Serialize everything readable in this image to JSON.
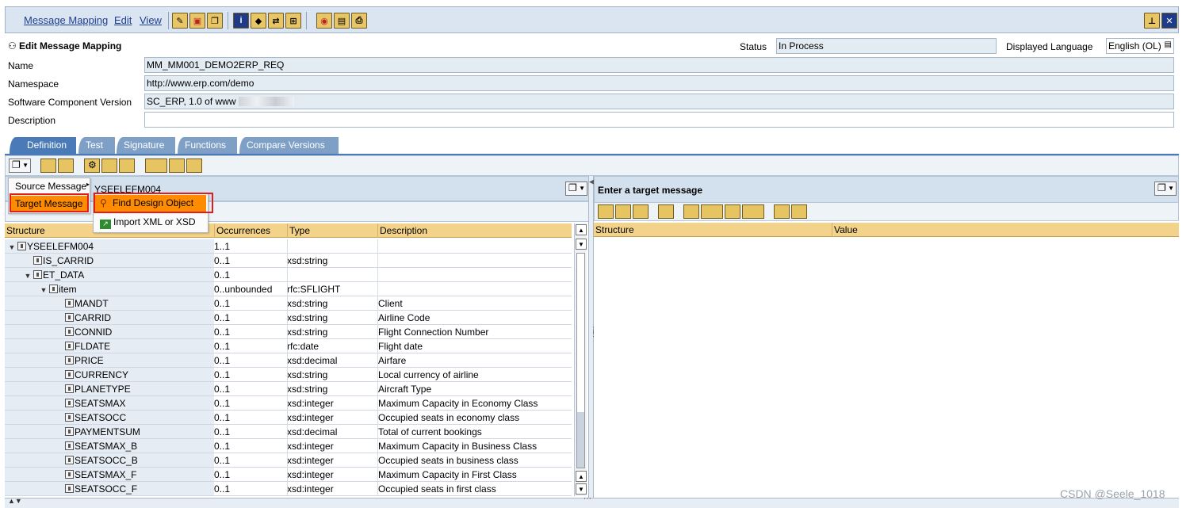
{
  "menu": {
    "items": [
      "Message Mapping",
      "Edit",
      "View"
    ]
  },
  "header": {
    "title": "Edit Message Mapping",
    "status_label": "Status",
    "status_value": "In Process",
    "language_label": "Displayed Language",
    "language_value": "English (OL)",
    "name_label": "Name",
    "name_value": "MM_MM001_DEMO2ERP_REQ",
    "namespace_label": "Namespace",
    "namespace_value": "http://www.erp.com/demo",
    "scv_label": "Software Component Version",
    "scv_value": "SC_ERP, 1.0 of www",
    "description_label": "Description",
    "description_value": ""
  },
  "tabs": [
    "Definition",
    "Test",
    "Signature",
    "Functions",
    "Compare Versions"
  ],
  "popup": {
    "source_message": "Source Message",
    "target_message": "Target Message",
    "find_design_object": "Find Design Object",
    "import_xml": "Import XML or XSD"
  },
  "left_panel": {
    "title": "YSEELEFM004",
    "columns": [
      "Structure",
      "Occurrences",
      "Type",
      "Description"
    ],
    "rows": [
      {
        "name": "YSEELEFM004",
        "occ": "1..1",
        "type": "",
        "desc": ""
      },
      {
        "name": "IS_CARRID",
        "occ": "0..1",
        "type": "xsd:string",
        "desc": ""
      },
      {
        "name": "ET_DATA",
        "occ": "0..1",
        "type": "",
        "desc": ""
      },
      {
        "name": "item",
        "occ": "0..unbounded",
        "type": "rfc:SFLIGHT",
        "desc": ""
      },
      {
        "name": "MANDT",
        "occ": "0..1",
        "type": "xsd:string",
        "desc": "Client"
      },
      {
        "name": "CARRID",
        "occ": "0..1",
        "type": "xsd:string",
        "desc": "Airline Code"
      },
      {
        "name": "CONNID",
        "occ": "0..1",
        "type": "xsd:string",
        "desc": "Flight Connection Number"
      },
      {
        "name": "FLDATE",
        "occ": "0..1",
        "type": "rfc:date",
        "desc": "Flight date"
      },
      {
        "name": "PRICE",
        "occ": "0..1",
        "type": "xsd:decimal",
        "desc": "Airfare"
      },
      {
        "name": "CURRENCY",
        "occ": "0..1",
        "type": "xsd:string",
        "desc": "Local currency of airline"
      },
      {
        "name": "PLANETYPE",
        "occ": "0..1",
        "type": "xsd:string",
        "desc": "Aircraft Type"
      },
      {
        "name": "SEATSMAX",
        "occ": "0..1",
        "type": "xsd:integer",
        "desc": "Maximum Capacity in Economy Class"
      },
      {
        "name": "SEATSOCC",
        "occ": "0..1",
        "type": "xsd:integer",
        "desc": "Occupied seats in economy class"
      },
      {
        "name": "PAYMENTSUM",
        "occ": "0..1",
        "type": "xsd:decimal",
        "desc": "Total of current bookings"
      },
      {
        "name": "SEATSMAX_B",
        "occ": "0..1",
        "type": "xsd:integer",
        "desc": "Maximum Capacity in Business Class"
      },
      {
        "name": "SEATSOCC_B",
        "occ": "0..1",
        "type": "xsd:integer",
        "desc": "Occupied seats in business class"
      },
      {
        "name": "SEATSMAX_F",
        "occ": "0..1",
        "type": "xsd:integer",
        "desc": "Maximum Capacity in First Class"
      },
      {
        "name": "SEATSOCC_F",
        "occ": "0..1",
        "type": "xsd:integer",
        "desc": "Occupied seats in first class"
      }
    ]
  },
  "right_panel": {
    "title": "Enter a target message",
    "columns": [
      "Structure",
      "Value"
    ]
  },
  "watermark": "CSDN @Seele_1018",
  "colors": {
    "accent": "#4a7ab7",
    "highlight": "#ff8c00",
    "grid_header": "#f3d38a",
    "toolbar_button": "#e6c461"
  }
}
